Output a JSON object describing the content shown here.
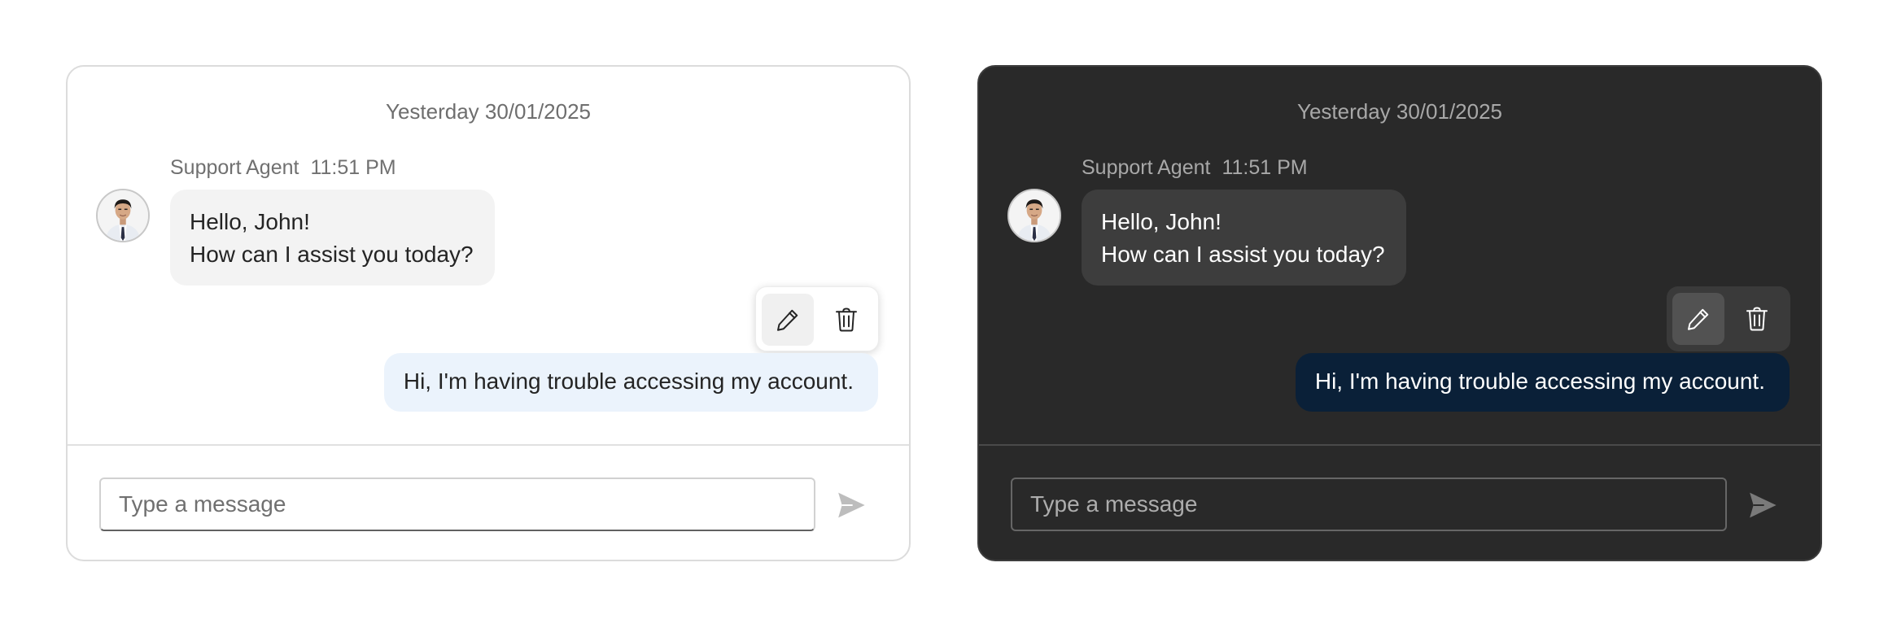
{
  "panels": [
    {
      "theme": "light",
      "date_separator": "Yesterday 30/01/2025",
      "incoming": {
        "sender": "Support Agent",
        "time": "11:51 PM",
        "lines": [
          "Hello, John!",
          "How can I assist you today?"
        ]
      },
      "outgoing": {
        "text": "Hi, I'm having trouble accessing my account."
      },
      "actions": {
        "edit_icon": "edit-pencil-icon",
        "delete_icon": "trash-icon"
      },
      "composer": {
        "placeholder": "Type a message",
        "send_icon": "send-icon"
      },
      "colors": {
        "icon": "#242424",
        "send": "#bdbdbd"
      }
    },
    {
      "theme": "dark",
      "date_separator": "Yesterday 30/01/2025",
      "incoming": {
        "sender": "Support Agent",
        "time": "11:51 PM",
        "lines": [
          "Hello, John!",
          "How can I assist you today?"
        ]
      },
      "outgoing": {
        "text": "Hi, I'm having trouble accessing my account."
      },
      "actions": {
        "edit_icon": "edit-pencil-icon",
        "delete_icon": "trash-icon"
      },
      "composer": {
        "placeholder": "Type a message",
        "send_icon": "send-icon"
      },
      "colors": {
        "icon": "#ffffff",
        "send": "#7a7a7a"
      }
    }
  ]
}
